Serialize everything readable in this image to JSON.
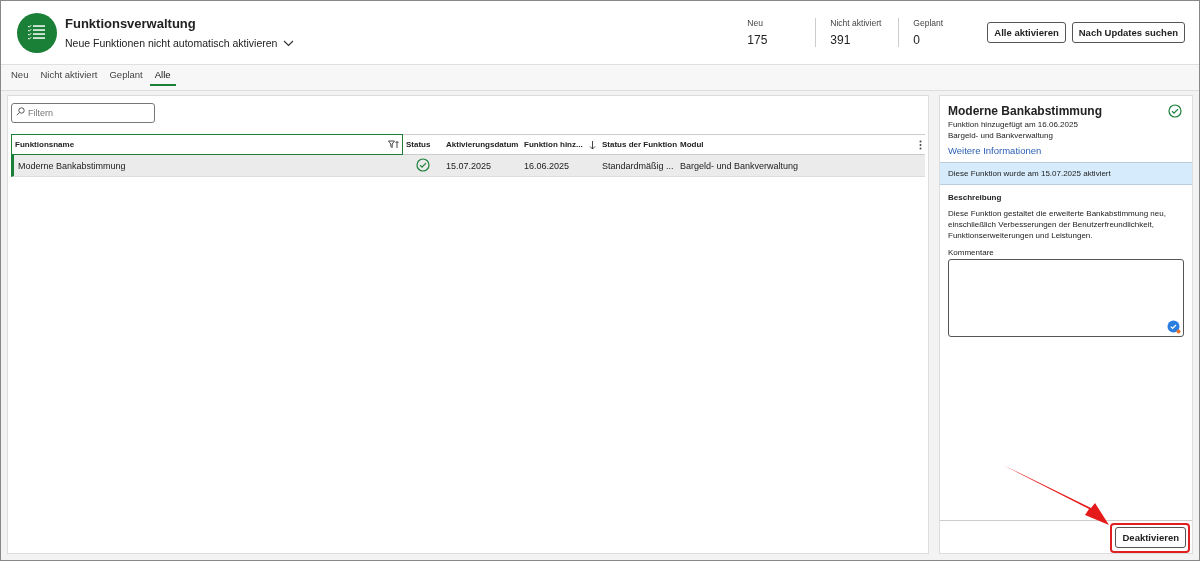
{
  "header": {
    "title": "Funktionsverwaltung",
    "subtitle": "Neue Funktionen nicht automatisch aktivieren",
    "stats": [
      {
        "label": "Neu",
        "value": "175"
      },
      {
        "label": "Nicht aktiviert",
        "value": "391"
      },
      {
        "label": "Geplant",
        "value": "0"
      }
    ],
    "buttons": [
      "Alle aktivieren",
      "Nach Updates suchen"
    ]
  },
  "tabs": [
    {
      "label": "Neu",
      "selected": false
    },
    {
      "label": "Nicht aktiviert",
      "selected": false
    },
    {
      "label": "Geplant",
      "selected": false
    },
    {
      "label": "Alle",
      "selected": true
    }
  ],
  "search": {
    "placeholder": "Filtern"
  },
  "table": {
    "columns": [
      {
        "label": "Funktionsname",
        "kind": "filter"
      },
      {
        "label": "Status",
        "kind": "plain"
      },
      {
        "label": "Aktivierungsdatum",
        "kind": "plain"
      },
      {
        "label": "Funktion hinz...",
        "kind": "sort"
      },
      {
        "label": "Status der Funktion",
        "kind": "plain"
      },
      {
        "label": "Modul",
        "kind": "menu"
      }
    ],
    "rows": [
      {
        "selected": true,
        "name": "Moderne Bankabstimmung",
        "activated": true,
        "activation_date": "15.07.2025",
        "added": "16.06.2025",
        "feature_status": "Standardmäßig ...",
        "module": "Bargeld- und Bankverwaltung"
      }
    ]
  },
  "detail": {
    "title": "Moderne Bankabstimmung",
    "activated": true,
    "meta": [
      "Funktion hinzugefügt am 16.06.2025",
      "Bargeld- und Bankverwaltung"
    ],
    "link": "Weitere Informationen",
    "notice": "Diese Funktion wurde am 15.07.2025 aktiviert",
    "description_heading": "Beschreibung",
    "description": "Diese Funktion gestaltet die erweiterte Bankabstimmung neu, einschließlich Verbesserungen der Benutzerfreundlichkeit, Funktionserweiterungen und Leistungen.",
    "comments_label": "Kommentare",
    "button": "Deaktivieren",
    "highlighted": true
  }
}
